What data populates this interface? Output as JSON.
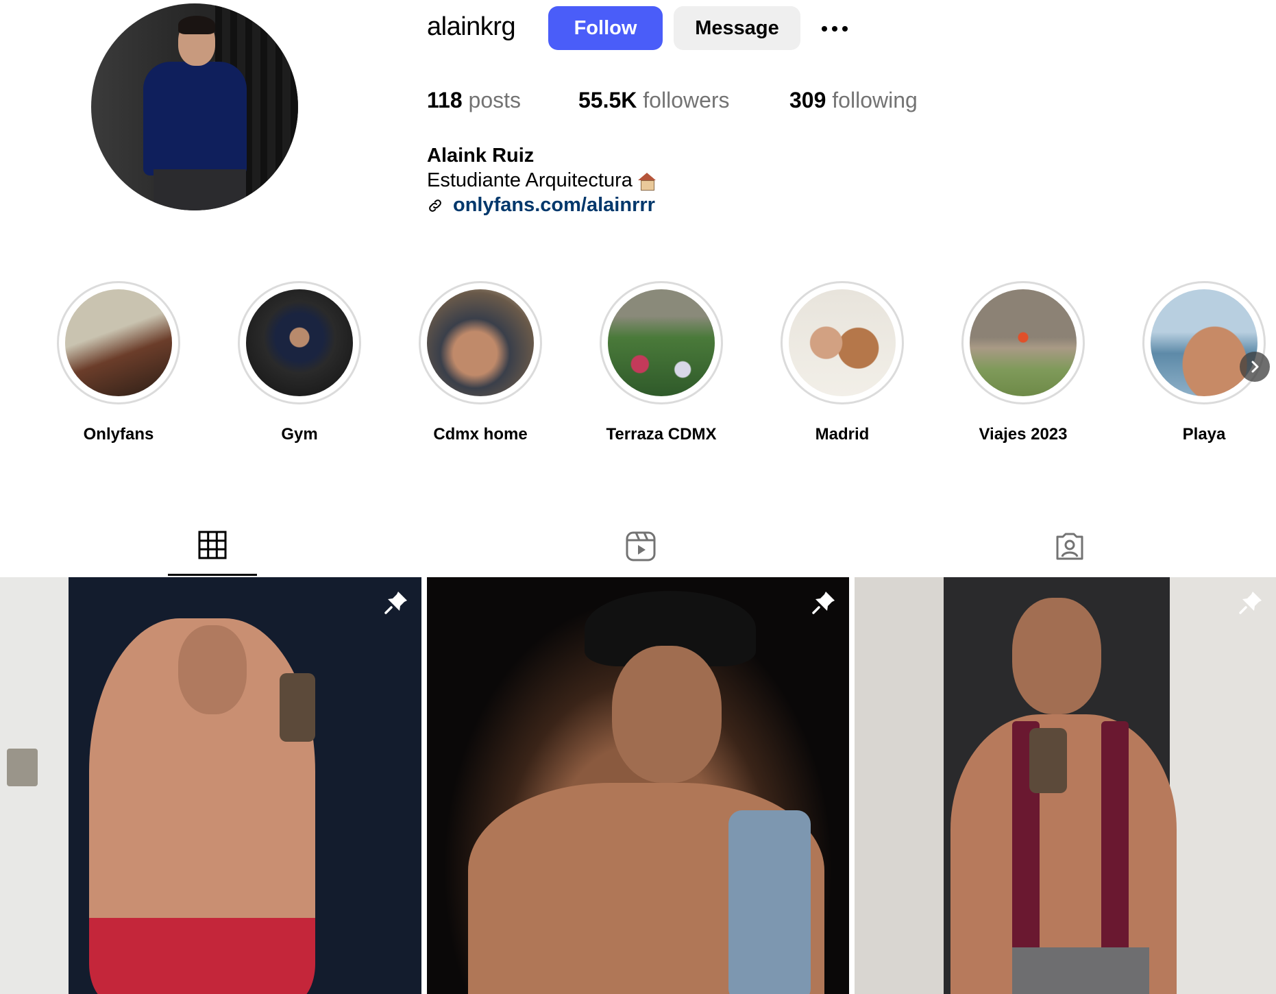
{
  "profile": {
    "username": "alainkrg",
    "follow_label": "Follow",
    "message_label": "Message",
    "more_label": "More options",
    "posts_count": "118",
    "posts_label": "posts",
    "followers_count": "55.5K",
    "followers_label": "followers",
    "following_count": "309",
    "following_label": "following",
    "full_name": "Alaink Ruiz",
    "bio": "Estudiante Arquitectura",
    "bio_emoji": "house-emoji",
    "link": "onlyfans.com/alainrrr"
  },
  "highlights": [
    {
      "label": "Onlyfans",
      "icon": "highlight-thumbnail"
    },
    {
      "label": "Gym",
      "icon": "highlight-thumbnail"
    },
    {
      "label": "Cdmx home",
      "icon": "highlight-thumbnail"
    },
    {
      "label": "Terraza CDMX",
      "icon": "highlight-thumbnail"
    },
    {
      "label": "Madrid",
      "icon": "highlight-thumbnail"
    },
    {
      "label": "Viajes 2023",
      "icon": "highlight-thumbnail"
    },
    {
      "label": "Playa",
      "icon": "highlight-thumbnail"
    }
  ],
  "tabs": [
    {
      "name": "posts",
      "icon": "grid-icon",
      "active": true
    },
    {
      "name": "reels",
      "icon": "reels-icon",
      "active": false
    },
    {
      "name": "tagged",
      "icon": "tagged-icon",
      "active": false
    }
  ],
  "posts": [
    {
      "pinned": true,
      "icon": "pin-icon"
    },
    {
      "pinned": true,
      "icon": "pin-icon"
    },
    {
      "pinned": true,
      "icon": "pin-icon"
    }
  ],
  "colors": {
    "follow_button": "#4a5df9",
    "message_button": "#efefef",
    "link": "#00376b",
    "stat_label": "#737373"
  }
}
